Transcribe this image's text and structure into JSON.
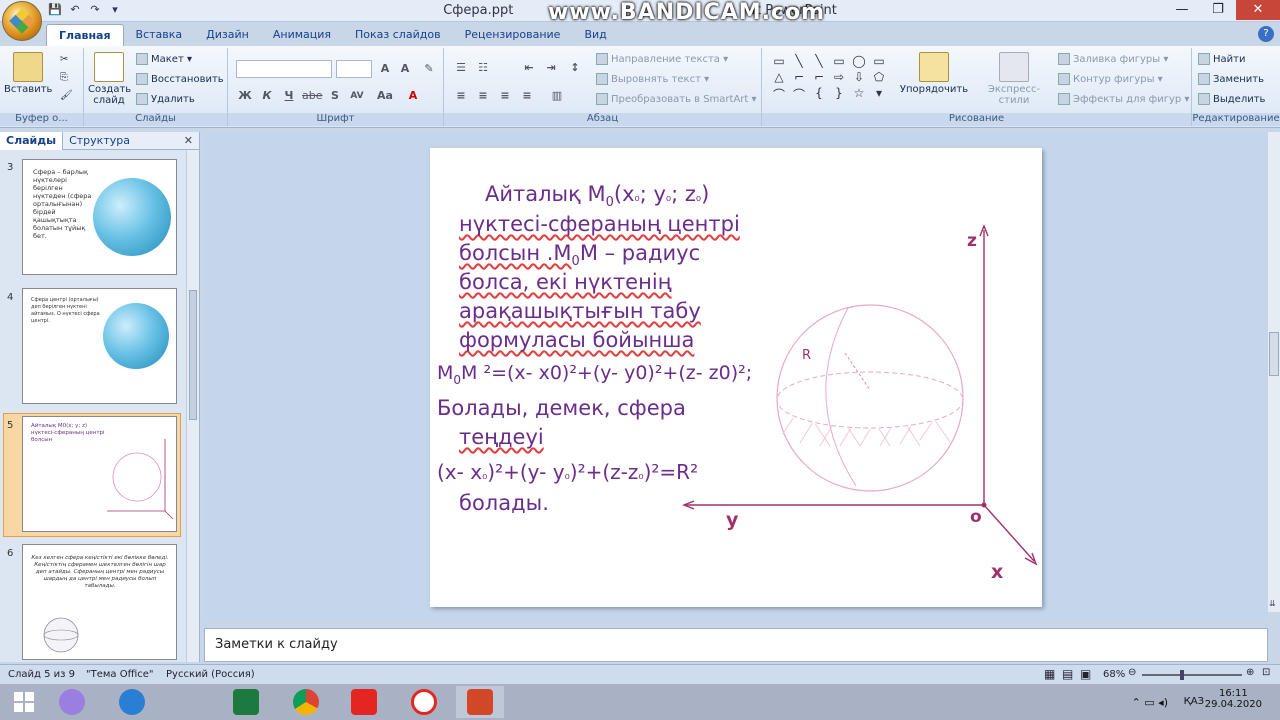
{
  "window": {
    "title_left": "Сфера.ppt",
    "title_right": "ft PowerPoint",
    "watermark": "www.BANDICAM.com",
    "min": "—",
    "max": "❐",
    "close": "✕"
  },
  "tabs": [
    "Главная",
    "Вставка",
    "Дизайн",
    "Анимация",
    "Показ слайдов",
    "Рецензирование",
    "Вид"
  ],
  "ribbon": {
    "clipboard": {
      "paste": "Вставить",
      "label": "Буфер о..."
    },
    "slides": {
      "new_slide": "Создать слайд",
      "layout": "Макет",
      "reset": "Восстановить",
      "delete": "Удалить",
      "label": "Слайды"
    },
    "font": {
      "bold": "Ж",
      "italic": "К",
      "underline": "Ч",
      "strike": "abe",
      "shadow": "S",
      "spacing": "AV",
      "case": "Aa",
      "color": "A",
      "label": "Шрифт"
    },
    "paragraph": {
      "direction": "Направление текста",
      "align": "Выровнять текст",
      "smartart": "Преобразовать в SmartArt",
      "label": "Абзац"
    },
    "drawing": {
      "arrange": "Упорядочить",
      "styles": "Экспресс-стили",
      "fill": "Заливка фигуры",
      "outline": "Контур фигуры",
      "effects": "Эффекты для фигур",
      "label": "Рисование"
    },
    "editing": {
      "find": "Найти",
      "replace": "Заменить",
      "select": "Выделить",
      "label": "Редактирование"
    }
  },
  "left_panel": {
    "tab_slides": "Слайды",
    "tab_outline": "Структура",
    "close": "✕",
    "thumbs": [
      {
        "num": "3",
        "text": "Сфера – барлық нүктелері берілген нүктеден (сфера орталығынан) бірдей қашықтықта болатын тұйық бет."
      },
      {
        "num": "4",
        "text": "Сфера центрі (орталығы) деп берілген нүктені айтамыз. О нүктесі сфера центрі."
      },
      {
        "num": "5",
        "text": "Айталық M0(x; y; z) нүктесі-сфераның центрі болсын"
      },
      {
        "num": "6",
        "text": "Кез келген сфера кеңістікті екі бөлікке бөледі. Кеңістіктің сферамен шектелген бөлігін шар деп атайды. Сфераның центрі мен радиусы шардың да центрі мен радиусы болып табылады."
      }
    ]
  },
  "slide": {
    "line1": "Айталық M",
    "line1_sub": "0",
    "line1_rest": "(x",
    "line1_tail": "; y",
    "line1_tail2": "; z",
    "line1_end": ")",
    "line2": "нүктесі-сфераның центрі",
    "line3a": "болсын .M",
    "line3b": "M – радиус",
    "line4": "болса, екі нүктенің",
    "line5": "арақашықтығын табу",
    "line6": "формуласы бойынша",
    "formula1a": "M",
    "formula1b": "M ²=(x- x0)²+(y- y0)²+(z- z0)²;",
    "line7": "Болады, демек, сфера",
    "line8": "теңдеуі",
    "formula2": "(x- x",
    "formula2b": ")²+(y- y",
    "formula2c": ")²+(z-z",
    "formula2d": ")²=R²",
    "line9": "болады.",
    "sub0": "0",
    "subo": "₀",
    "axis_z": "z",
    "axis_y": "y",
    "axis_x": "x",
    "origin": "o",
    "radius": "R"
  },
  "notes": "Заметки к слайду",
  "status": {
    "slide": "Слайд 5 из 9",
    "theme": "\"Тема Office\"",
    "lang": "Русский (Россия)",
    "zoom": "68%"
  },
  "tray": {
    "lang": "ҚАЗ",
    "time": "16:11",
    "date": "29.04.2020"
  },
  "colors": {
    "text": "#6b2d8c",
    "axis": "#a0306a",
    "sphere": "#e38bb8"
  }
}
